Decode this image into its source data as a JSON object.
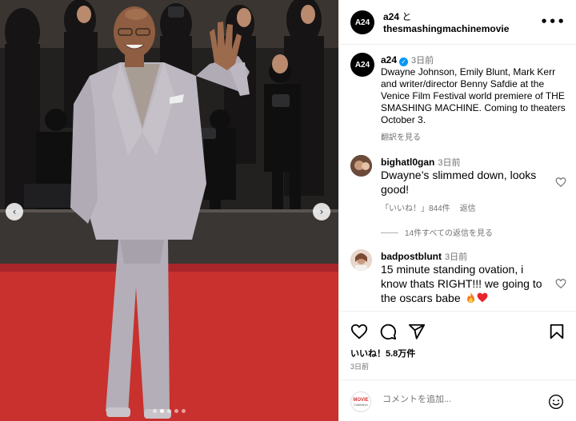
{
  "photo": {
    "prev_arrow": "‹",
    "next_arrow": "›",
    "carousel_dots": 5,
    "carousel_active_index": 1
  },
  "header": {
    "account_1": "a24",
    "connector": " と",
    "account_2": "thesmashingmachinemovie",
    "more_label": "•••"
  },
  "caption": {
    "logo_text": "A24",
    "username": "a24",
    "verified_mark": "✓",
    "time": "3日前",
    "text": "Dwayne Johnson, Emily Blunt, Mark Kerr and writer/director Benny Safdie at the Venice Film Festival world premiere of THE SMASHING MACHINE. Coming to theaters October 3.",
    "translate": "翻訳を見る"
  },
  "comments": [
    {
      "username": "bighatl0gan",
      "time": "3日前",
      "text": "Dwayne’s slimmed down, looks good!",
      "likes": "「いいね！」844件",
      "reply": "返信"
    },
    {
      "username": "badpostblunt",
      "time": "3日前",
      "text": "15 minute standing ovation, i know thats RIGHT!!! we going to the oscars babe"
    }
  ],
  "view_replies": "14件すべての返信を見る",
  "actions": {
    "likes": "いいね！5.8万件",
    "post_time": "3日前"
  },
  "add_comment": {
    "logo_line1": "MOVIE",
    "logo_line2": "Collection",
    "placeholder": "コメントを追加..."
  },
  "colors": {
    "carpet": "#c8312e",
    "suit": "#b9b4bd",
    "verified": "#0095f6",
    "secondary_text": "#737373"
  },
  "icons": [
    "chevron-left-icon",
    "chevron-right-icon",
    "more-icon",
    "verified-icon",
    "heart-icon",
    "comment-icon",
    "share-icon",
    "bookmark-icon",
    "smile-icon",
    "fire-emoji",
    "heart-emoji"
  ]
}
